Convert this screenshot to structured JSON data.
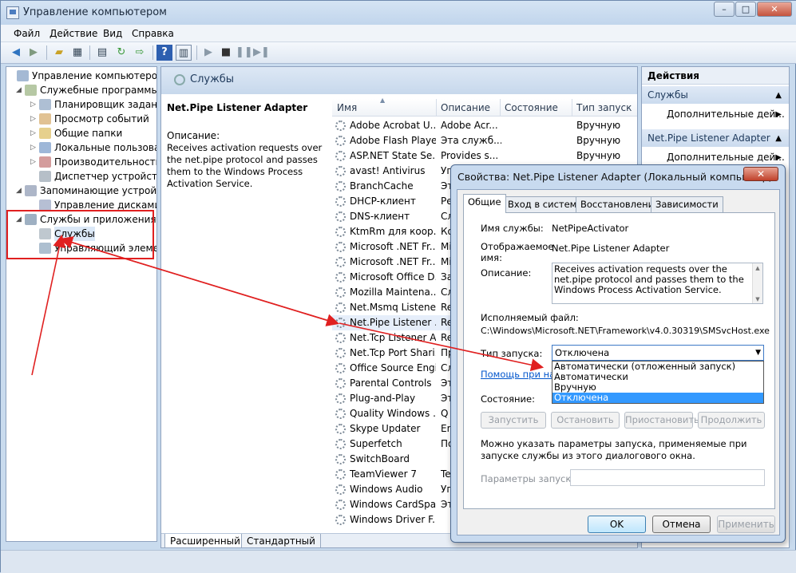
{
  "window": {
    "title": "Управление компьютером",
    "controls": [
      "–",
      "□",
      "✕"
    ]
  },
  "menu": [
    "Файл",
    "Действие",
    "Вид",
    "Справка"
  ],
  "toolbar_icons": [
    "back-icon",
    "forward-icon",
    "up-folder-icon",
    "show-tree-icon",
    "properties-icon",
    "refresh-icon",
    "export-icon",
    "help-icon",
    "toggle-pane-icon",
    "play-icon",
    "stop-icon",
    "pause-icon",
    "restart-icon"
  ],
  "tree": [
    {
      "label": "Управление компьютером (л",
      "level": 0,
      "toggle": ""
    },
    {
      "label": "Служебные программы",
      "level": 1,
      "toggle": "◢"
    },
    {
      "label": "Планировщик заданий",
      "level": 2,
      "toggle": "▷"
    },
    {
      "label": "Просмотр событий",
      "level": 2,
      "toggle": "▷"
    },
    {
      "label": "Общие папки",
      "level": 2,
      "toggle": "▷"
    },
    {
      "label": "Локальные пользовате",
      "level": 2,
      "toggle": "▷"
    },
    {
      "label": "Производительность",
      "level": 2,
      "toggle": "▷"
    },
    {
      "label": "Диспетчер устройств",
      "level": 2,
      "toggle": ""
    },
    {
      "label": "Запоминающие устройств",
      "level": 1,
      "toggle": "◢"
    },
    {
      "label": "Управление дисками",
      "level": 2,
      "toggle": ""
    },
    {
      "label": "Службы и приложения",
      "level": 1,
      "toggle": "◢"
    },
    {
      "label": "Службы",
      "level": 2,
      "toggle": ""
    },
    {
      "label": "Управляющий элемен",
      "level": 2,
      "toggle": ""
    }
  ],
  "services_pane": {
    "title": "Службы",
    "selected_name": "Net.Pipe Listener Adapter",
    "desc_label": "Описание:",
    "desc_text": "Receives activation requests over the net.pipe protocol and passes them to the Windows Process Activation Service.",
    "columns": [
      "Имя",
      "Описание",
      "Состояние",
      "Тип запуск"
    ],
    "rows": [
      {
        "name": "Adobe Acrobat U...",
        "desc": "Adobe Acr...",
        "start": "Вручную"
      },
      {
        "name": "Adobe Flash Playe...",
        "desc": "Эта служб...",
        "start": "Вручную"
      },
      {
        "name": "ASP.NET State Se...",
        "desc": "Provides s...",
        "start": "Вручную"
      },
      {
        "name": "avast! Antivirus",
        "desc": "Уп",
        "start": ""
      },
      {
        "name": "BranchCache",
        "desc": "Эт",
        "start": ""
      },
      {
        "name": "DHCP-клиент",
        "desc": "Ре",
        "start": ""
      },
      {
        "name": "DNS-клиент",
        "desc": "Сл",
        "start": ""
      },
      {
        "name": "KtmRm для коор...",
        "desc": "Ко",
        "start": ""
      },
      {
        "name": "Microsoft .NET Fr...",
        "desc": "Mi",
        "start": ""
      },
      {
        "name": "Microsoft .NET Fr...",
        "desc": "Mi",
        "start": ""
      },
      {
        "name": "Microsoft Office D...",
        "desc": "За",
        "start": ""
      },
      {
        "name": "Mozilla Maintena...",
        "desc": "Сл",
        "start": ""
      },
      {
        "name": "Net.Msmq Listene...",
        "desc": "Re",
        "start": ""
      },
      {
        "name": "Net.Pipe Listener ...",
        "desc": "Re",
        "start": ""
      },
      {
        "name": "Net.Tcp Listener A...",
        "desc": "Re",
        "start": ""
      },
      {
        "name": "Net.Tcp Port Shari...",
        "desc": "Пр",
        "start": ""
      },
      {
        "name": "Office Source Engi...",
        "desc": "Сл",
        "start": ""
      },
      {
        "name": "Parental Controls",
        "desc": "Эт",
        "start": ""
      },
      {
        "name": "Plug-and-Play",
        "desc": "Эт",
        "start": ""
      },
      {
        "name": "Quality Windows ...",
        "desc": "Q",
        "start": ""
      },
      {
        "name": "Skype Updater",
        "desc": "En",
        "start": ""
      },
      {
        "name": "Superfetch",
        "desc": "По",
        "start": ""
      },
      {
        "name": "SwitchBoard",
        "desc": "",
        "start": ""
      },
      {
        "name": "TeamViewer 7",
        "desc": "Te",
        "start": ""
      },
      {
        "name": "Windows Audio",
        "desc": "Уп",
        "start": ""
      },
      {
        "name": "Windows CardSpa...",
        "desc": "Эт",
        "start": ""
      },
      {
        "name": "Windows Driver F...",
        "desc": "",
        "start": ""
      }
    ],
    "bottom_tabs": [
      "Расширенный",
      "Стандартный"
    ]
  },
  "actions": {
    "title": "Действия",
    "sections": [
      {
        "header": "Службы",
        "item": "Дополнительные дей..."
      },
      {
        "header": "Net.Pipe Listener Adapter",
        "item": "Дополнительные дей..."
      }
    ]
  },
  "dialog": {
    "title": "Свойства: Net.Pipe Listener Adapter (Локальный компьютер)",
    "close": "✕",
    "tabs": [
      "Общие",
      "Вход в систему",
      "Восстановление",
      "Зависимости"
    ],
    "service_name_label": "Имя службы:",
    "service_name": "NetPipeActivator",
    "display_name_label": "Отображаемое имя:",
    "display_name": "Net.Pipe Listener Adapter",
    "description_label": "Описание:",
    "description": "Receives activation requests over the net.pipe protocol and passes them to the Windows Process Activation Service.",
    "exe_label": "Исполняемый файл:",
    "exe_path": "C:\\Windows\\Microsoft.NET\\Framework\\v4.0.30319\\SMSvcHost.exe",
    "startup_label": "Тип запуска:",
    "startup_value": "Отключена",
    "startup_options": [
      "Автоматически (отложенный запуск)",
      "Автоматически",
      "Вручную",
      "Отключена"
    ],
    "highlighted_option": "Отключена",
    "help_link": "Помощь при наст",
    "state_label": "Состояние:",
    "buttons": [
      "Запустить",
      "Остановить",
      "Приостановить",
      "Продолжить"
    ],
    "hint": "Можно указать параметры запуска, применяемые при запуске службы из этого диалогового окна.",
    "params_label": "Параметры запуска:",
    "footer": {
      "ok": "OK",
      "cancel": "Отмена",
      "apply": "Применить"
    }
  },
  "colors": {
    "annotation": "#e02020",
    "selection": "#3399ff"
  }
}
